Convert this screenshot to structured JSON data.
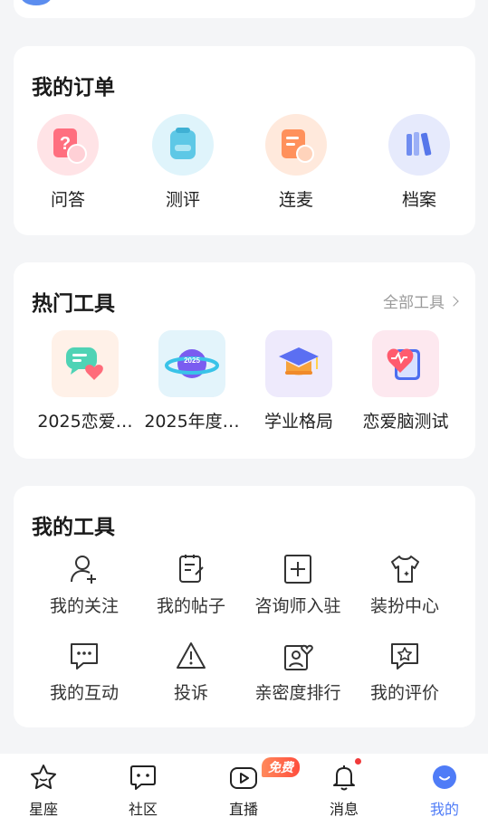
{
  "orders": {
    "title": "我的订单",
    "items": [
      {
        "label": "问答",
        "icon": "question-card-icon"
      },
      {
        "label": "测评",
        "icon": "assessment-icon"
      },
      {
        "label": "连麦",
        "icon": "voice-call-icon"
      },
      {
        "label": "档案",
        "icon": "archive-icon"
      }
    ]
  },
  "hot_tools": {
    "title": "热门工具",
    "more_label": "全部工具",
    "items": [
      {
        "label": "2025恋爱…",
        "icon": "love-chat-icon"
      },
      {
        "label": "2025年度…",
        "icon": "planet-2025-icon"
      },
      {
        "label": "学业格局",
        "icon": "graduation-cap-icon"
      },
      {
        "label": "恋爱脑测试",
        "icon": "heart-test-icon"
      }
    ]
  },
  "my_tools": {
    "title": "我的工具",
    "items": [
      {
        "label": "我的关注",
        "icon": "user-follow-icon"
      },
      {
        "label": "我的帖子",
        "icon": "posts-icon"
      },
      {
        "label": "咨询师入驻",
        "icon": "add-square-icon"
      },
      {
        "label": "装扮中心",
        "icon": "tshirt-icon"
      },
      {
        "label": "我的互动",
        "icon": "chat-dots-icon"
      },
      {
        "label": "投诉",
        "icon": "warning-icon"
      },
      {
        "label": "亲密度排行",
        "icon": "intimacy-rank-icon"
      },
      {
        "label": "我的评价",
        "icon": "review-star-icon"
      }
    ]
  },
  "tabbar": {
    "items": [
      {
        "label": "星座",
        "icon": "star-icon"
      },
      {
        "label": "社区",
        "icon": "community-chat-icon"
      },
      {
        "label": "直播",
        "icon": "live-play-icon"
      },
      {
        "label": "消息",
        "icon": "bell-icon"
      },
      {
        "label": "我的",
        "icon": "profile-smile-icon"
      }
    ],
    "active": "我的",
    "live_badge": "免费",
    "accent_color": "#4f7cf7"
  }
}
